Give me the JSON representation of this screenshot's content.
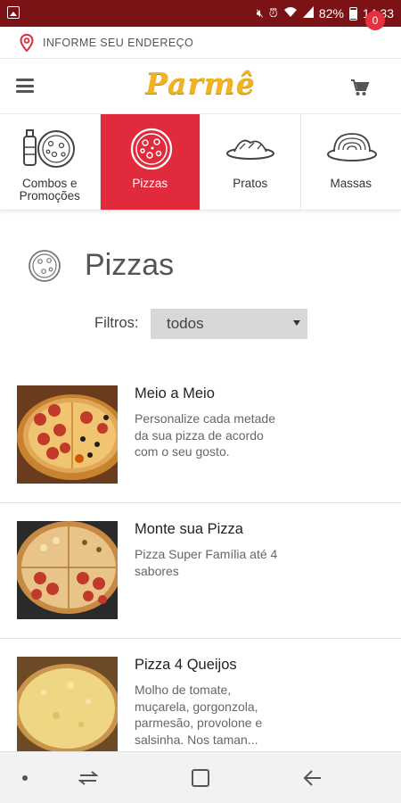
{
  "status_bar": {
    "battery": "82%",
    "time": "14:33",
    "icons": [
      "gallery-icon",
      "mute-icon",
      "alarm-icon",
      "wifi-icon",
      "signal-icon",
      "battery-icon"
    ]
  },
  "address": {
    "label": "INFORME SEU ENDEREÇO",
    "icon": "location-pin-icon"
  },
  "header": {
    "logo": "Parmê",
    "cart_count": "0",
    "logo_color": "#f0b323",
    "accent_color": "#e12a3c"
  },
  "categories": [
    {
      "line1": "Combos e",
      "line2": "Promoções",
      "icon": "combo-icon",
      "active": false
    },
    {
      "label": "Pizzas",
      "icon": "pizza-icon",
      "active": true
    },
    {
      "label": "Pratos",
      "icon": "plate-icon",
      "active": false
    },
    {
      "label": "Massas",
      "icon": "pasta-icon",
      "active": false
    }
  ],
  "section": {
    "title": "Pizzas"
  },
  "filters": {
    "label": "Filtros:",
    "selected": "todos"
  },
  "products": [
    {
      "name": "Meio a Meio",
      "desc_lines": [
        "Personalize cada metade",
        "da sua pizza de acordo",
        "com o seu gosto."
      ]
    },
    {
      "name": "Monte sua Pizza",
      "desc_lines": [
        "Pizza Super Família até 4",
        "sabores"
      ]
    },
    {
      "name": "Pizza 4 Queijos",
      "desc_lines": [
        "Molho de tomate,",
        "muçarela, gorgonzola,",
        "parmesão, provolone e",
        "salsinha. Nos taman..."
      ]
    }
  ],
  "navbar": {
    "icons": [
      "dot-icon",
      "recent-apps-icon",
      "home-icon",
      "back-icon"
    ]
  }
}
